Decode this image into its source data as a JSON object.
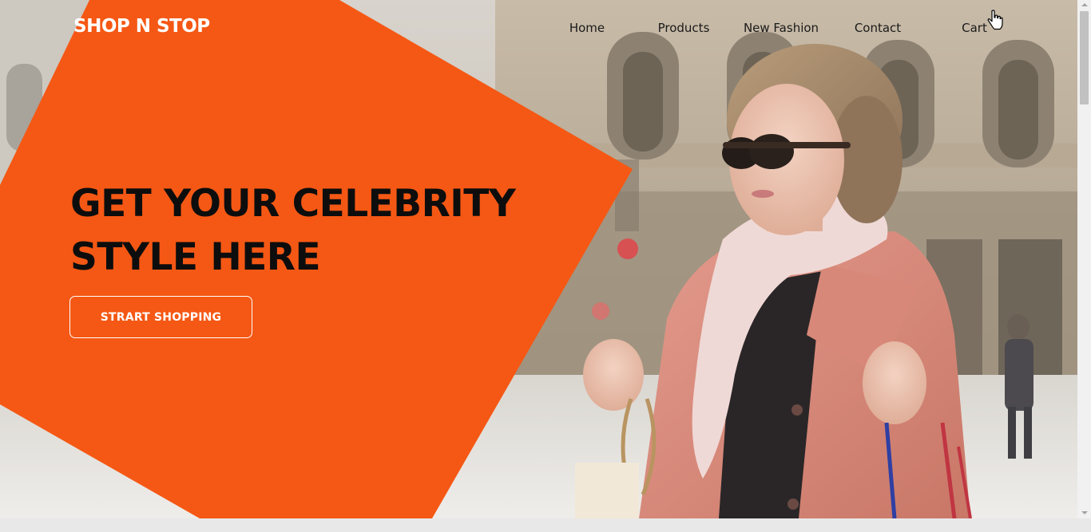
{
  "brand": {
    "logo_text": "SHOP N STOP"
  },
  "nav": {
    "items": [
      {
        "label": "Home"
      },
      {
        "label": "Products"
      },
      {
        "label": "New Fashion"
      },
      {
        "label": "Contact"
      },
      {
        "label": "Cart"
      }
    ]
  },
  "hero": {
    "title_line1": "GET YOUR CELEBRITY",
    "title_line2": "STYLE HERE",
    "cta_label": "STRART SHOPPING"
  },
  "colors": {
    "accent": "#f55814",
    "title_text": "#0d0d0d",
    "nav_text": "#1a1a1a"
  },
  "icons": {
    "cursor": "hand-pointer-icon"
  }
}
